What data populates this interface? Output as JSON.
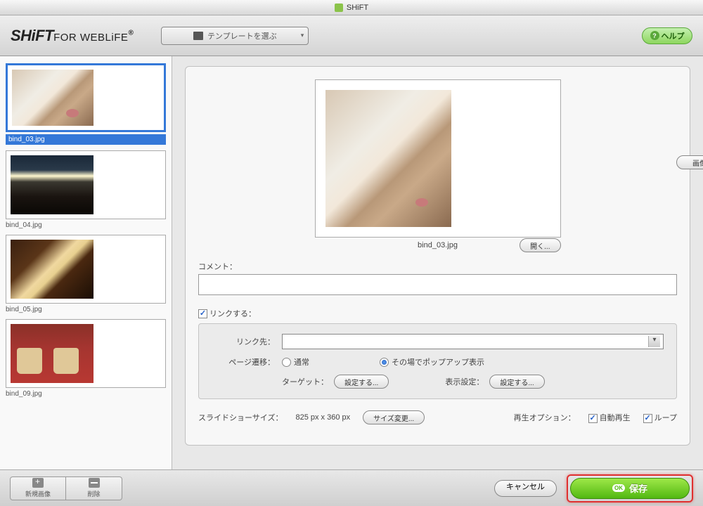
{
  "window": {
    "title": "SHiFT"
  },
  "toolbar": {
    "logo_main": "SHiFT",
    "logo_sub": "FOR WEBLiFE",
    "logo_reg": "®",
    "template_btn": "テンプレートを選ぶ",
    "help": "ヘルプ"
  },
  "sidebar": {
    "items": [
      {
        "label": "bind_03.jpg",
        "selected": true,
        "img": "dog"
      },
      {
        "label": "bind_04.jpg",
        "selected": false,
        "img": "sky"
      },
      {
        "label": "bind_05.jpg",
        "selected": false,
        "img": "desk"
      },
      {
        "label": "bind_09.jpg",
        "selected": false,
        "img": "plant"
      }
    ]
  },
  "preview": {
    "filename": "bind_03.jpg",
    "edit_btn": "画像編集",
    "open_btn": "開く..."
  },
  "comment": {
    "label": "コメント："
  },
  "link": {
    "check_label": "リンクする：",
    "dest_label": "リンク先：",
    "transition_label": "ページ遷移：",
    "radio_normal": "通常",
    "radio_popup": "その場でポップアップ表示",
    "target_label": "ターゲット：",
    "target_btn": "設定する...",
    "display_label": "表示設定：",
    "display_btn": "設定する..."
  },
  "slideshow": {
    "size_label": "スライドショーサイズ：",
    "size_value": "825 px x 360 px",
    "resize_btn": "サイズ変更...",
    "play_option_label": "再生オプション：",
    "autoplay": "自動再生",
    "loop": "ループ"
  },
  "footer": {
    "new_image": "新規画像",
    "delete": "削除",
    "cancel": "キャンセル",
    "save": "保存"
  }
}
